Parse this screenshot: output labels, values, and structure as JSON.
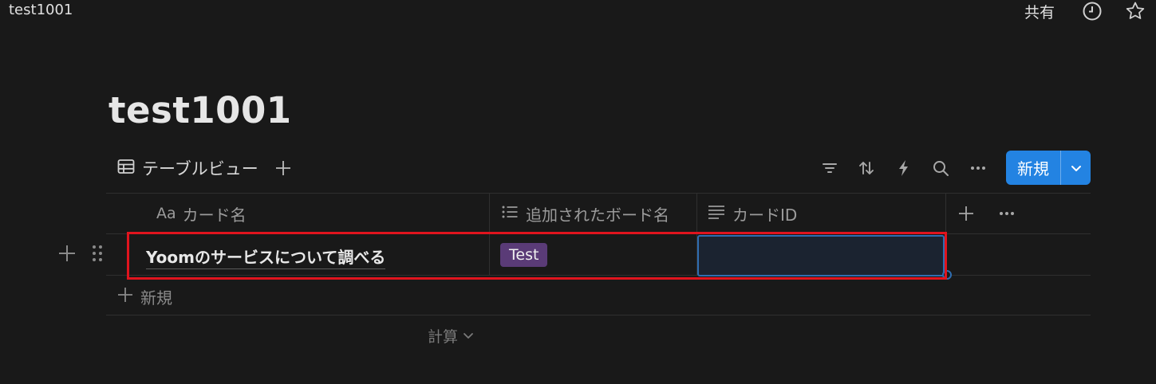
{
  "topbar": {
    "breadcrumb": "test1001",
    "share_label": "共有",
    "icons": [
      "clock-icon",
      "star-icon"
    ]
  },
  "page": {
    "title": "test1001"
  },
  "view": {
    "tab_label": "テーブルビュー",
    "tab_icon": "table-icon",
    "add_icon": "plus-icon"
  },
  "toolbar": {
    "icons": [
      "filter-icon",
      "sort-icon",
      "lightning-icon",
      "search-icon",
      "more-icon"
    ],
    "new_button_label": "新規",
    "new_button_color": "#2383e2"
  },
  "table": {
    "columns": [
      {
        "prefix": "Aa",
        "label": "カード名"
      },
      {
        "icon": "list-icon",
        "label": "追加されたボード名"
      },
      {
        "icon": "text-icon",
        "label": "カードID"
      }
    ],
    "rows": [
      {
        "card_name": "Yoomのサービスについて調べる",
        "board_tag": "Test",
        "card_id": ""
      }
    ],
    "tag_color": "#5a3b77",
    "new_row_label": "新規",
    "calc_label": "計算"
  },
  "highlight_color": "#e0141e"
}
